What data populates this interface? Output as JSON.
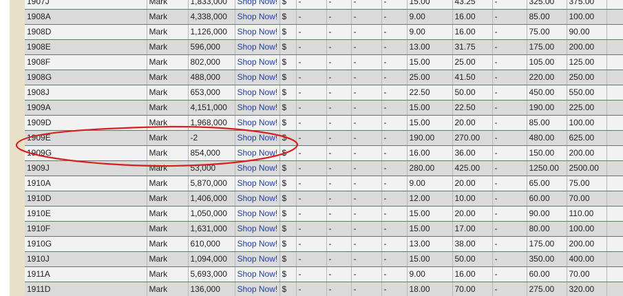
{
  "table": {
    "rows": [
      {
        "date": "1907J",
        "type": "Mark",
        "mintage": "1,833,000",
        "shop": "Shop Now!",
        "currency": "$",
        "c1": "-",
        "c2": "-",
        "c3": "-",
        "c4": "-",
        "g1": "15.00",
        "g2": "43.25",
        "g3": "-",
        "g4": "325.00",
        "g5": "375.00",
        "g6": ""
      },
      {
        "date": "1908A",
        "type": "Mark",
        "mintage": "4,338,000",
        "shop": "Shop Now!",
        "currency": "$",
        "c1": "-",
        "c2": "-",
        "c3": "-",
        "c4": "-",
        "g1": "9.00",
        "g2": "16.00",
        "g3": "-",
        "g4": "85.00",
        "g5": "100.00",
        "g6": ""
      },
      {
        "date": "1908D",
        "type": "Mark",
        "mintage": "1,126,000",
        "shop": "Shop Now!",
        "currency": "$",
        "c1": "-",
        "c2": "-",
        "c3": "-",
        "c4": "-",
        "g1": "9.00",
        "g2": "16.00",
        "g3": "-",
        "g4": "75.00",
        "g5": "90.00",
        "g6": ""
      },
      {
        "date": "1908E",
        "type": "Mark",
        "mintage": "596,000",
        "shop": "Shop Now!",
        "currency": "$",
        "c1": "-",
        "c2": "-",
        "c3": "-",
        "c4": "-",
        "g1": "13.00",
        "g2": "31.75",
        "g3": "-",
        "g4": "175.00",
        "g5": "200.00",
        "g6": ""
      },
      {
        "date": "1908F",
        "type": "Mark",
        "mintage": "802,000",
        "shop": "Shop Now!",
        "currency": "$",
        "c1": "-",
        "c2": "-",
        "c3": "-",
        "c4": "-",
        "g1": "15.00",
        "g2": "25.00",
        "g3": "-",
        "g4": "105.00",
        "g5": "125.00",
        "g6": ""
      },
      {
        "date": "1908G",
        "type": "Mark",
        "mintage": "488,000",
        "shop": "Shop Now!",
        "currency": "$",
        "c1": "-",
        "c2": "-",
        "c3": "-",
        "c4": "-",
        "g1": "25.00",
        "g2": "41.50",
        "g3": "-",
        "g4": "220.00",
        "g5": "250.00",
        "g6": ""
      },
      {
        "date": "1908J",
        "type": "Mark",
        "mintage": "653,000",
        "shop": "Shop Now!",
        "currency": "$",
        "c1": "-",
        "c2": "-",
        "c3": "-",
        "c4": "-",
        "g1": "22.50",
        "g2": "50.00",
        "g3": "-",
        "g4": "450.00",
        "g5": "550.00",
        "g6": ""
      },
      {
        "date": "1909A",
        "type": "Mark",
        "mintage": "4,151,000",
        "shop": "Shop Now!",
        "currency": "$",
        "c1": "-",
        "c2": "-",
        "c3": "-",
        "c4": "-",
        "g1": "15.00",
        "g2": "22.50",
        "g3": "-",
        "g4": "190.00",
        "g5": "225.00",
        "g6": ""
      },
      {
        "date": "1909D",
        "type": "Mark",
        "mintage": "1,968,000",
        "shop": "Shop Now!",
        "currency": "$",
        "c1": "-",
        "c2": "-",
        "c3": "-",
        "c4": "-",
        "g1": "15.00",
        "g2": "20.00",
        "g3": "-",
        "g4": "85.00",
        "g5": "100.00",
        "g6": ""
      },
      {
        "date": "1909E",
        "type": "Mark",
        "mintage": "-2",
        "shop": "Shop Now!",
        "currency": "$",
        "c1": "-",
        "c2": "-",
        "c3": "-",
        "c4": "-",
        "g1": "190.00",
        "g2": "270.00",
        "g3": "-",
        "g4": "480.00",
        "g5": "625.00",
        "g6": ""
      },
      {
        "date": "1909G",
        "type": "Mark",
        "mintage": "854,000",
        "shop": "Shop Now!",
        "currency": "$",
        "c1": "-",
        "c2": "-",
        "c3": "-",
        "c4": "-",
        "g1": "16.00",
        "g2": "36.00",
        "g3": "-",
        "g4": "150.00",
        "g5": "200.00",
        "g6": ""
      },
      {
        "date": "1909J",
        "type": "Mark",
        "mintage": "53,000",
        "shop": "Shop Now!",
        "currency": "$",
        "c1": "-",
        "c2": "-",
        "c3": "-",
        "c4": "-",
        "g1": "280.00",
        "g2": "425.00",
        "g3": "-",
        "g4": "1250.00",
        "g5": "2500.00",
        "g6": ""
      },
      {
        "date": "1910A",
        "type": "Mark",
        "mintage": "5,870,000",
        "shop": "Shop Now!",
        "currency": "$",
        "c1": "-",
        "c2": "-",
        "c3": "-",
        "c4": "-",
        "g1": "9.00",
        "g2": "20.00",
        "g3": "-",
        "g4": "65.00",
        "g5": "75.00",
        "g6": ""
      },
      {
        "date": "1910D",
        "type": "Mark",
        "mintage": "1,406,000",
        "shop": "Shop Now!",
        "currency": "$",
        "c1": "-",
        "c2": "-",
        "c3": "-",
        "c4": "-",
        "g1": "12.00",
        "g2": "10.00",
        "g3": "-",
        "g4": "60.00",
        "g5": "70.00",
        "g6": ""
      },
      {
        "date": "1910E",
        "type": "Mark",
        "mintage": "1,050,000",
        "shop": "Shop Now!",
        "currency": "$",
        "c1": "-",
        "c2": "-",
        "c3": "-",
        "c4": "-",
        "g1": "15.00",
        "g2": "20.00",
        "g3": "-",
        "g4": "90.00",
        "g5": "110.00",
        "g6": ""
      },
      {
        "date": "1910F",
        "type": "Mark",
        "mintage": "1,631,000",
        "shop": "Shop Now!",
        "currency": "$",
        "c1": "-",
        "c2": "-",
        "c3": "-",
        "c4": "-",
        "g1": "15.00",
        "g2": "17.00",
        "g3": "-",
        "g4": "80.00",
        "g5": "100.00",
        "g6": ""
      },
      {
        "date": "1910G",
        "type": "Mark",
        "mintage": "610,000",
        "shop": "Shop Now!",
        "currency": "$",
        "c1": "-",
        "c2": "-",
        "c3": "-",
        "c4": "-",
        "g1": "13.00",
        "g2": "38.00",
        "g3": "-",
        "g4": "175.00",
        "g5": "200.00",
        "g6": ""
      },
      {
        "date": "1910J",
        "type": "Mark",
        "mintage": "1,094,000",
        "shop": "Shop Now!",
        "currency": "$",
        "c1": "-",
        "c2": "-",
        "c3": "-",
        "c4": "-",
        "g1": "15.00",
        "g2": "50.00",
        "g3": "-",
        "g4": "350.00",
        "g5": "400.00",
        "g6": ""
      },
      {
        "date": "1911A",
        "type": "Mark",
        "mintage": "5,693,000",
        "shop": "Shop Now!",
        "currency": "$",
        "c1": "-",
        "c2": "-",
        "c3": "-",
        "c4": "-",
        "g1": "9.00",
        "g2": "16.00",
        "g3": "-",
        "g4": "60.00",
        "g5": "70.00",
        "g6": ""
      },
      {
        "date": "1911D",
        "type": "Mark",
        "mintage": "136,000",
        "shop": "Shop Now!",
        "currency": "$",
        "c1": "-",
        "c2": "-",
        "c3": "-",
        "c4": "-",
        "g1": "18.00",
        "g2": "70.00",
        "g3": "-",
        "g4": "275.00",
        "g5": "320.00",
        "g6": ""
      }
    ]
  },
  "annotation": {
    "highlighted_row": "1909E",
    "color": "#d42020"
  },
  "colors": {
    "row_light": "#f2f2f2",
    "row_dark": "#dadada",
    "row_border": "#5a6fae",
    "link": "#1f3f9a",
    "side_stripe": "#e8e0c8"
  }
}
